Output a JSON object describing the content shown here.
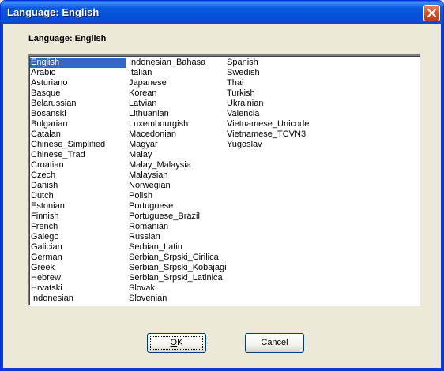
{
  "window": {
    "title": "Language: English"
  },
  "heading": "Language: English",
  "languages": {
    "col1": [
      "English",
      "Arabic",
      "Asturiano",
      "Basque",
      "Belarussian",
      "Bosanski",
      "Bulgarian",
      "Catalan",
      "Chinese_Simplified",
      "Chinese_Trad",
      "Croatian",
      "Czech",
      "Danish",
      "Dutch",
      "Estonian",
      "Finnish",
      "French",
      "Galego",
      "Galician",
      "German",
      "Greek",
      "Hebrew",
      "Hrvatski",
      "Indonesian"
    ],
    "col2": [
      "Indonesian_Bahasa",
      "Italian",
      "Japanese",
      "Korean",
      "Latvian",
      "Lithuanian",
      "Luxembourgish",
      "Macedonian",
      "Magyar",
      "Malay",
      "Malay_Malaysia",
      "Malaysian",
      "Norwegian",
      "Polish",
      "Portuguese",
      "Portuguese_Brazil",
      "Romanian",
      "Russian",
      "Serbian_Latin",
      "Serbian_Srpski_Cirilica",
      "Serbian_Srpski_Kobajagi",
      "Serbian_Srpski_Latinica",
      "Slovak",
      "Slovenian"
    ],
    "col3": [
      "Spanish",
      "Swedish",
      "Thai",
      "Turkish",
      "Ukrainian",
      "Valencia",
      "Vietnamese_Unicode",
      "Vietnamese_TCVN3",
      "Yugoslav"
    ],
    "selected": "English"
  },
  "buttons": {
    "ok": "OK",
    "cancel": "Cancel"
  },
  "colors": {
    "selection": "#316ac5",
    "titlebar": "#0552d6",
    "close": "#d9502a"
  },
  "icons": {
    "close": "close-icon"
  }
}
